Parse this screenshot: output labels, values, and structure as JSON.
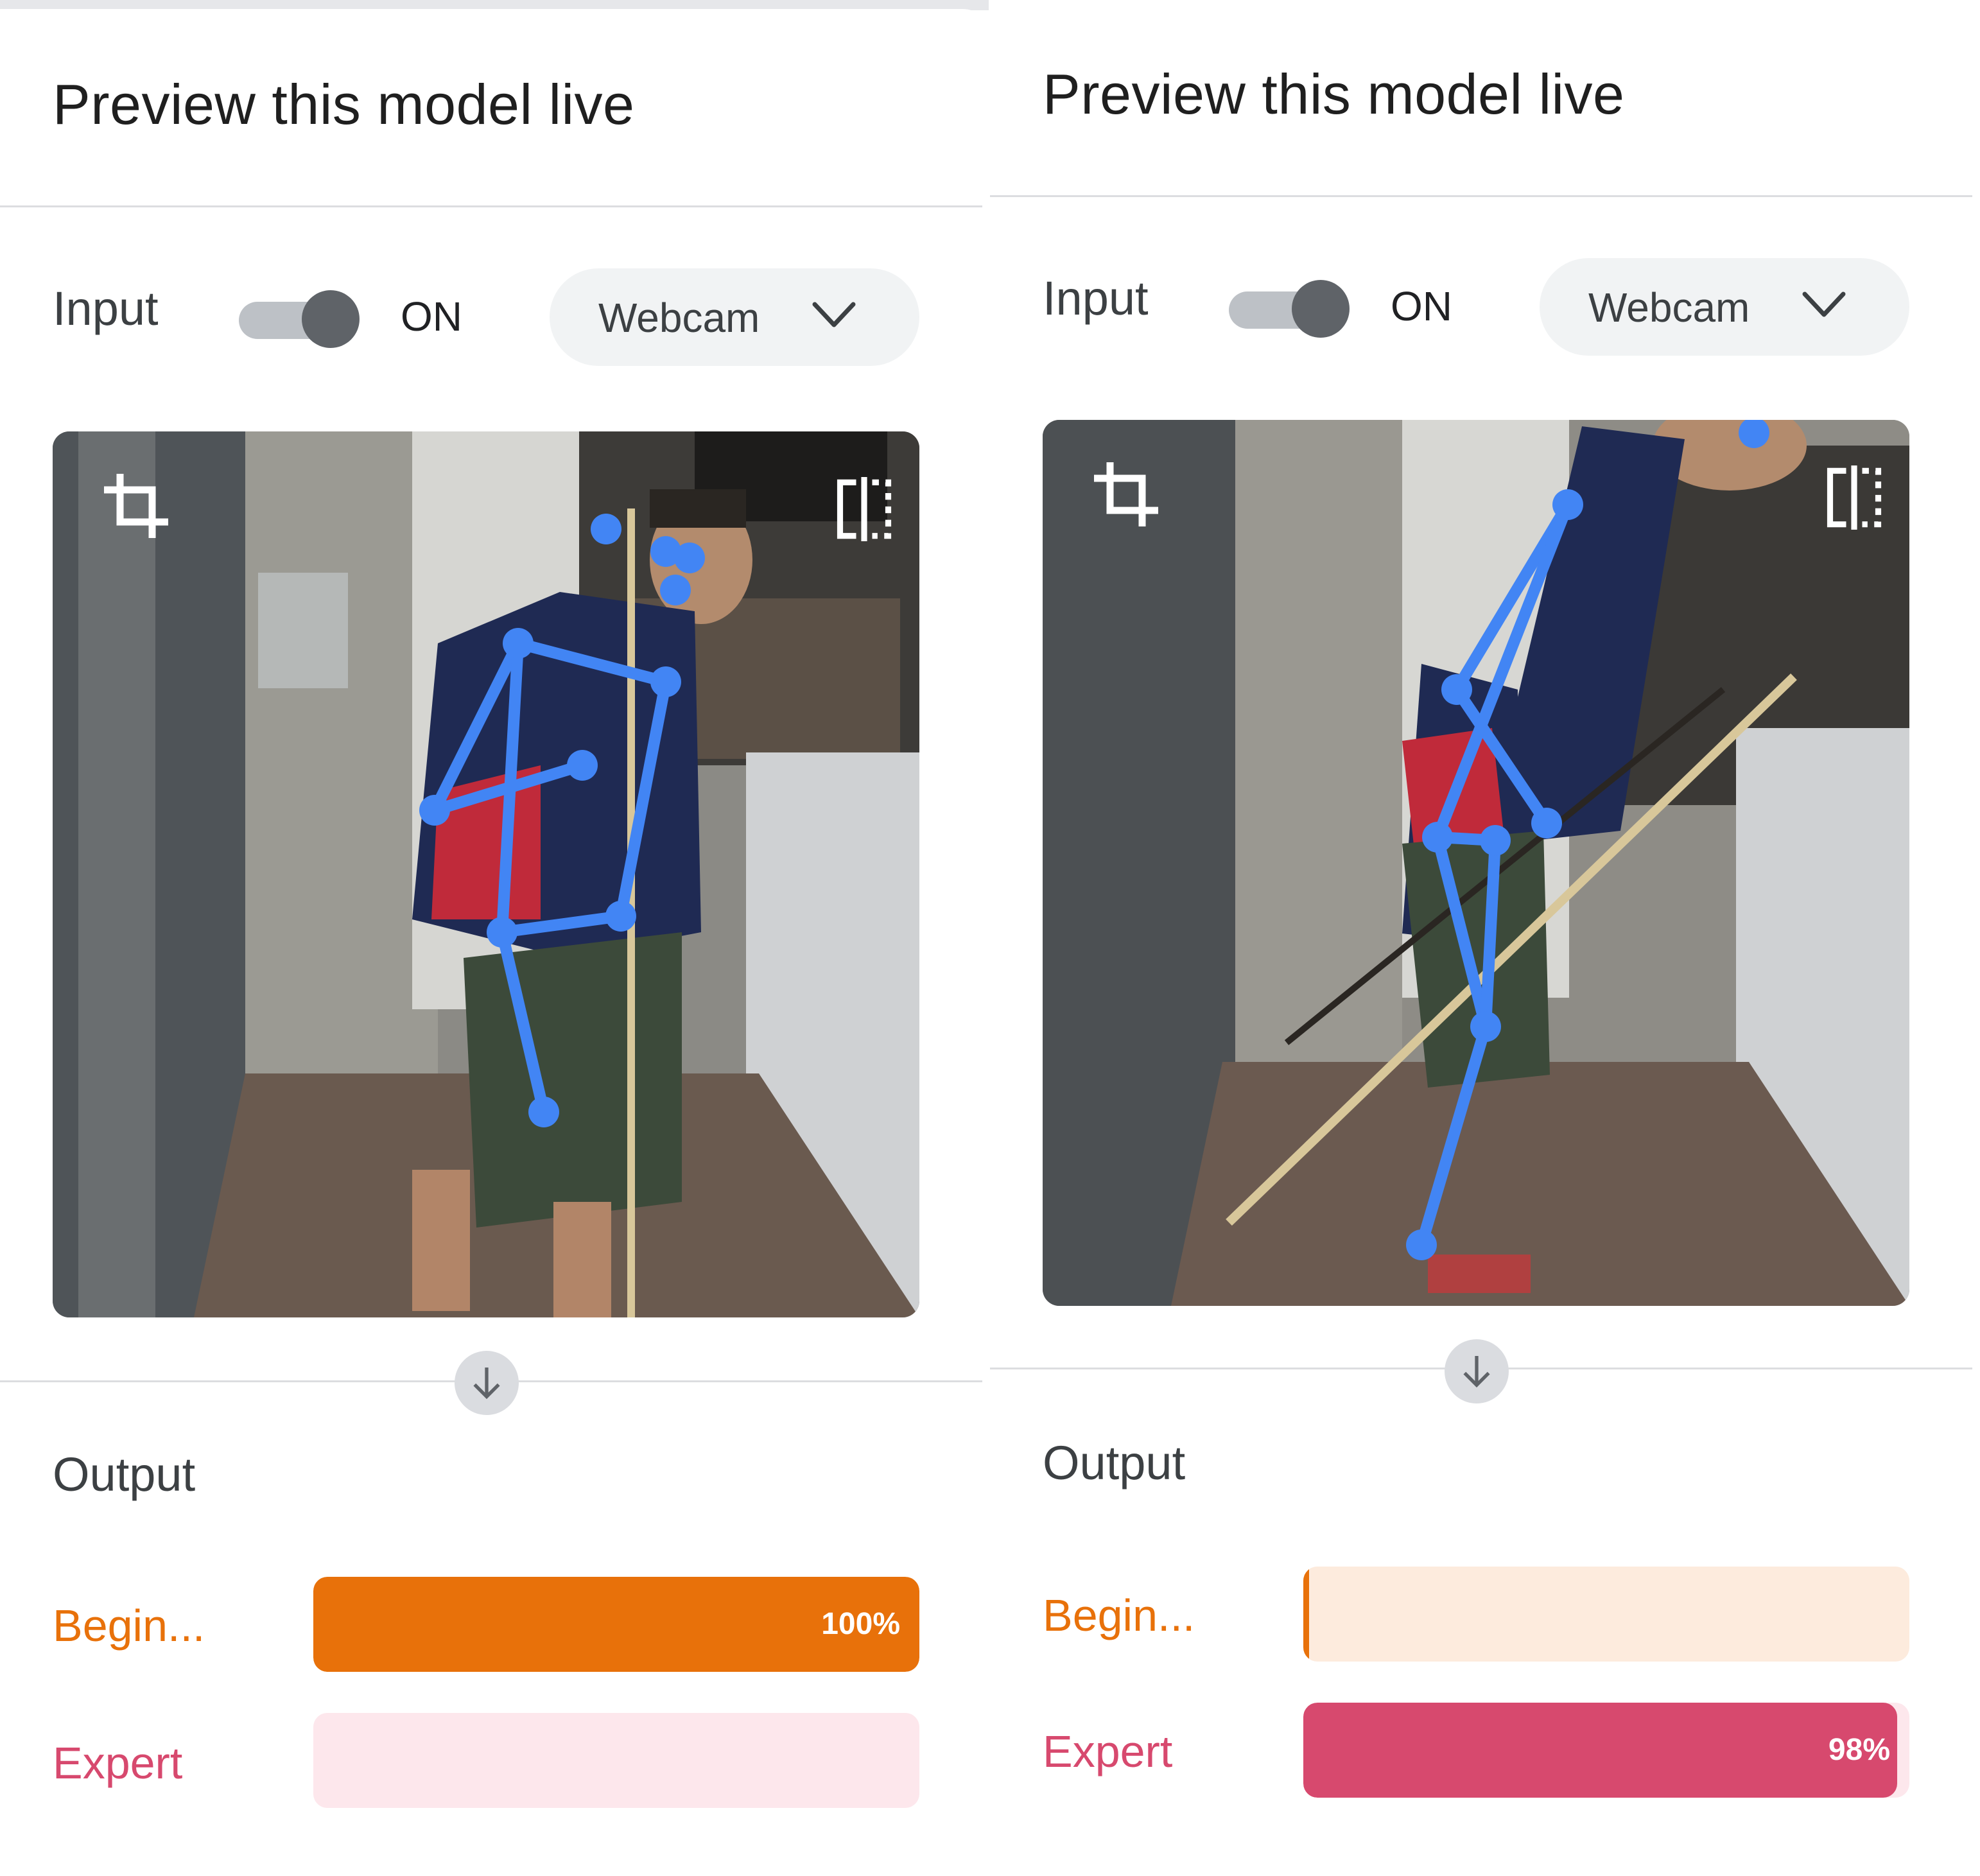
{
  "panels": [
    {
      "title": "Preview this model live",
      "input_label": "Input",
      "toggle_state": "ON",
      "source_select": "Webcam",
      "output_label": "Output",
      "classes": [
        {
          "label": "Begin...",
          "value": 1.0,
          "value_text": "100%",
          "color": "#e8710a",
          "bg": "#fdebdd"
        },
        {
          "label": "Expert",
          "value": 0.0,
          "value_text": "",
          "color": "#d7496e",
          "bg": "#fde7ec"
        }
      ]
    },
    {
      "title": "Preview this model live",
      "input_label": "Input",
      "toggle_state": "ON",
      "source_select": "Webcam",
      "output_label": "Output",
      "classes": [
        {
          "label": "Begin...",
          "value": 0.01,
          "value_text": "",
          "color": "#e8710a",
          "bg": "#fdebdd"
        },
        {
          "label": "Expert",
          "value": 0.98,
          "value_text": "98%",
          "color": "#d7496e",
          "bg": "#fde7ec"
        }
      ]
    }
  ],
  "icons": {
    "crop": "crop-icon",
    "flip": "flip-horizontal-icon",
    "arrow": "arrow-down-icon",
    "chevron": "chevron-down-icon"
  },
  "colors": {
    "skeleton": "#4285f4",
    "beginner": "#e8710a",
    "expert": "#d7496e"
  }
}
